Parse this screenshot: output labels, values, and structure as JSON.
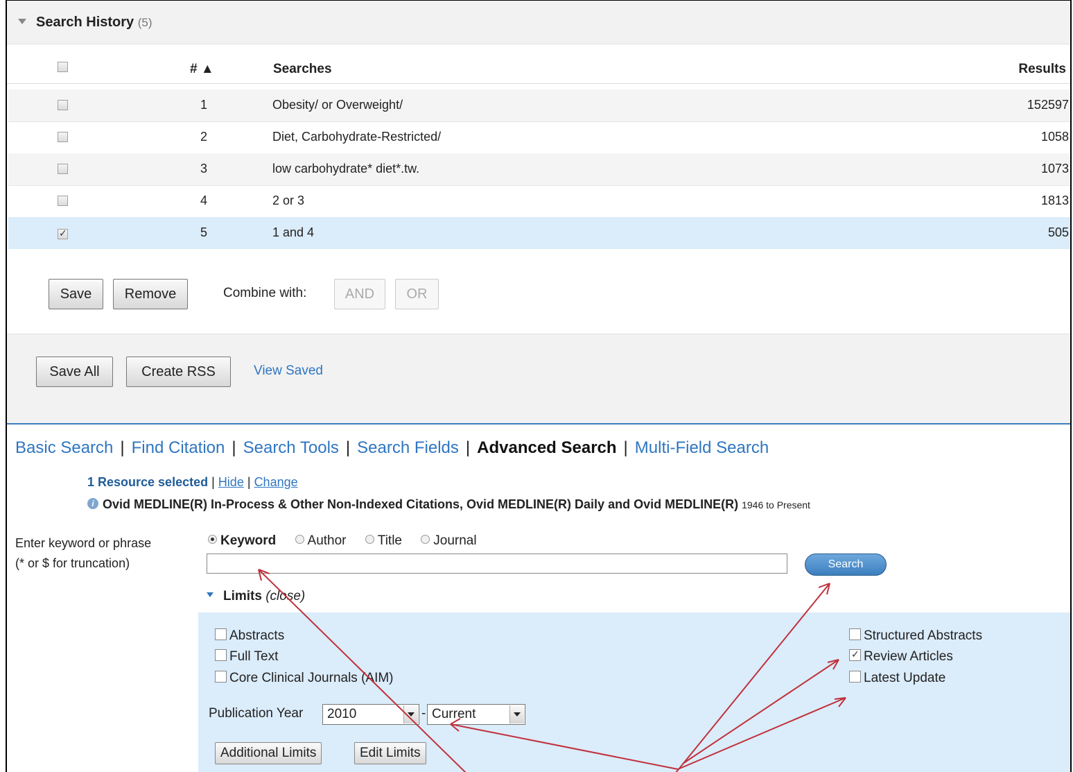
{
  "history": {
    "title": "Search History",
    "count": "(5)",
    "columns": {
      "num": "# ▲",
      "searches": "Searches",
      "results": "Results"
    },
    "rows": [
      {
        "num": "1",
        "query": "Obesity/ or Overweight/",
        "results": "152597",
        "checked": false
      },
      {
        "num": "2",
        "query": "Diet, Carbohydrate-Restricted/",
        "results": "1058",
        "checked": false
      },
      {
        "num": "3",
        "query": "low carbohydrate* diet*.tw.",
        "results": "1073",
        "checked": false
      },
      {
        "num": "4",
        "query": "2 or 3",
        "results": "1813",
        "checked": false
      },
      {
        "num": "5",
        "query": "1 and 4",
        "results": "505",
        "checked": true
      }
    ],
    "save_label": "Save",
    "remove_label": "Remove",
    "combine_label": "Combine with:",
    "and_label": "AND",
    "or_label": "OR",
    "save_all_label": "Save All",
    "create_rss_label": "Create RSS",
    "view_saved_label": "View Saved"
  },
  "tabs": {
    "basic": "Basic Search",
    "citation": "Find Citation",
    "tools": "Search Tools",
    "fields": "Search Fields",
    "advanced": "Advanced Search",
    "multi": "Multi-Field Search"
  },
  "resource": {
    "selected": "1 Resource selected",
    "hide": "Hide",
    "change": "Change",
    "database": "Ovid MEDLINE(R) In-Process & Other Non-Indexed Citations, Ovid MEDLINE(R) Daily and Ovid MEDLINE(R)",
    "range": "1946 to Present"
  },
  "search": {
    "prompt_line1": "Enter keyword or phrase",
    "prompt_line2": "(* or $ for truncation)",
    "modes": {
      "keyword": "Keyword",
      "author": "Author",
      "title": "Title",
      "journal": "Journal"
    },
    "input_value": "",
    "button": "Search"
  },
  "limits": {
    "heading": "Limits",
    "close": "(close)",
    "abstracts": "Abstracts",
    "full_text": "Full Text",
    "core_clinical": "Core Clinical Journals (AIM)",
    "structured": "Structured Abstracts",
    "review": "Review Articles",
    "latest": "Latest Update",
    "pub_year_label": "Publication Year",
    "year_from": "2010",
    "year_dash": "-",
    "year_to": "Current",
    "additional": "Additional Limits",
    "edit": "Edit Limits"
  },
  "colors": {
    "link": "#2f76c0",
    "selected_row": "#dbecfa",
    "arrow": "#c0303a"
  }
}
